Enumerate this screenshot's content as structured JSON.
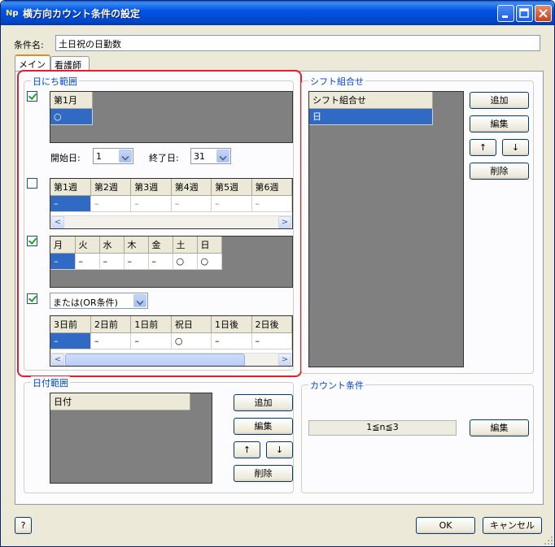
{
  "window": {
    "title": "横方向カウント条件の設定",
    "icon_text": "N",
    "icon_subtext": "p",
    "controls": [
      "minimize-icon",
      "maximize-icon",
      "close-icon"
    ]
  },
  "condition_name": {
    "label": "条件名:",
    "value": "土日祝の日勤数"
  },
  "tabs": [
    {
      "label": "メイン",
      "active": true
    },
    {
      "label": "看護師",
      "active": false
    }
  ],
  "date_range_group": {
    "title": "日にち範囲",
    "month_grid": {
      "checked": true,
      "headers": [
        "第1月"
      ],
      "values": [
        "○"
      ]
    },
    "start_label": "開始日:",
    "start_value": "1",
    "end_label": "終了日:",
    "end_value": "31",
    "week_grid": {
      "checked": false,
      "headers": [
        "第1週",
        "第2週",
        "第3週",
        "第4週",
        "第5週",
        "第6週"
      ],
      "values": [
        "–",
        "–",
        "–",
        "–",
        "–",
        "–"
      ]
    },
    "weekday_grid": {
      "checked": true,
      "headers": [
        "月",
        "火",
        "水",
        "木",
        "金",
        "土",
        "日"
      ],
      "values": [
        "–",
        "–",
        "–",
        "–",
        "–",
        "○",
        "○"
      ]
    },
    "holiday": {
      "checked": true,
      "combo_value": "または(OR条件)",
      "headers": [
        "3日前",
        "2日前",
        "1日前",
        "祝日",
        "1日後",
        "2日後"
      ],
      "values": [
        "–",
        "–",
        "–",
        "○",
        "–",
        "–"
      ]
    }
  },
  "shift_group": {
    "title": "シフト組合せ",
    "header": "シフト組合せ",
    "items": [
      "日"
    ],
    "buttons": {
      "add": "追加",
      "edit": "編集",
      "up": "↑",
      "down": "↓",
      "delete": "削除"
    }
  },
  "dates_group": {
    "title": "日付範囲",
    "header": "日付",
    "buttons": {
      "add": "追加",
      "edit": "編集",
      "up": "↑",
      "down": "↓",
      "delete": "削除"
    }
  },
  "count_group": {
    "title": "カウント条件",
    "value": "1≦n≦3",
    "edit_button": "編集"
  },
  "footer": {
    "help": "?",
    "ok": "OK",
    "cancel": "キャンセル"
  },
  "colors": {
    "highlight": "#e0202c",
    "selection": "#316ac5",
    "group_title": "#0046d5"
  }
}
